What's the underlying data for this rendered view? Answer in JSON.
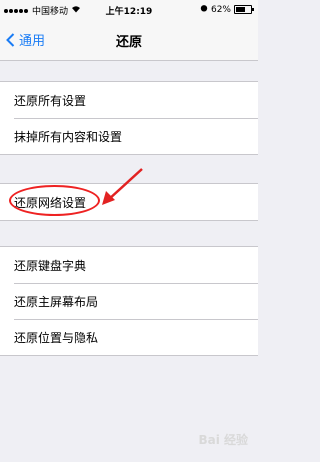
{
  "status": {
    "carrier": "中国移动",
    "time": "上午12:19",
    "battery_percent": "62%",
    "battery_level": 0.62
  },
  "nav": {
    "back_label": "通用",
    "title": "还原"
  },
  "group1": {
    "items": [
      "还原所有设置",
      "抹掉所有内容和设置"
    ]
  },
  "group2": {
    "items": [
      "还原网络设置"
    ]
  },
  "group3": {
    "items": [
      "还原键盘字典",
      "还原主屏幕布局",
      "还原位置与隐私"
    ]
  },
  "annotation": {
    "color": "#e22222"
  },
  "watermark": "Bai 经验"
}
